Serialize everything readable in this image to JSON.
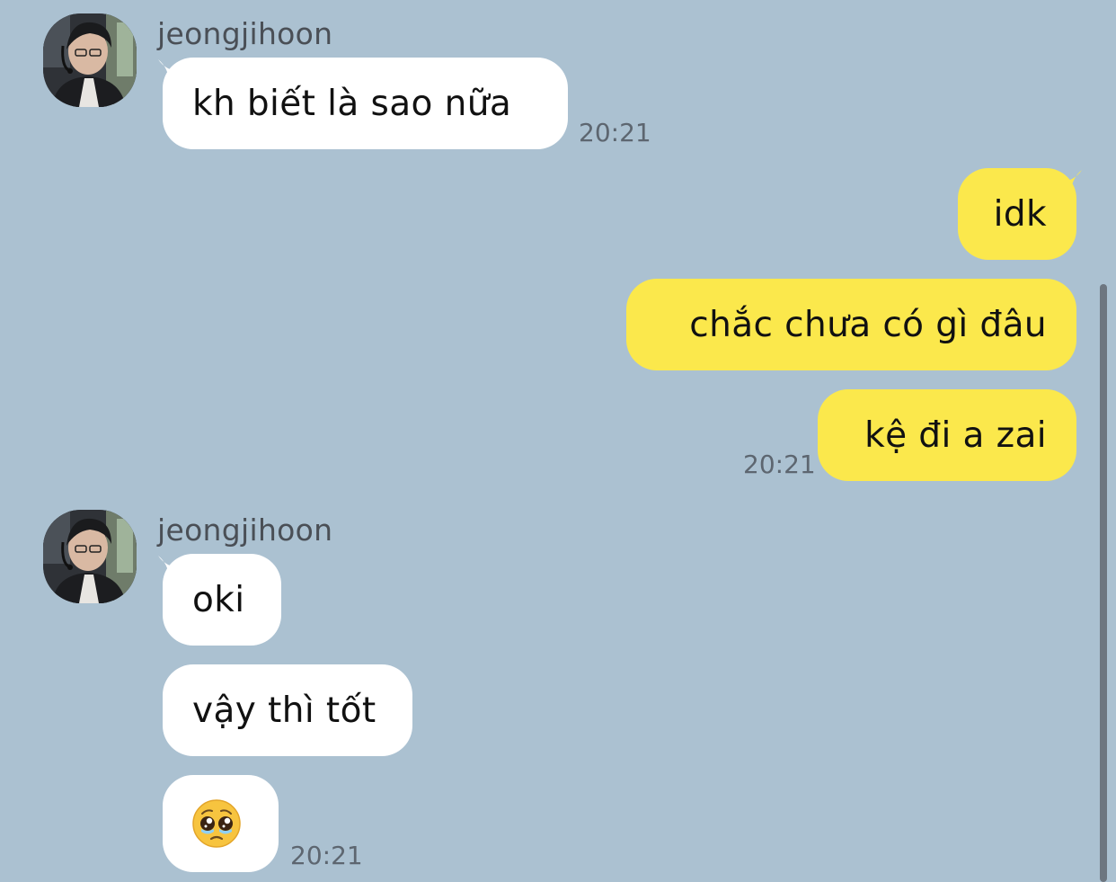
{
  "app": {
    "background_color": "#abc1d1",
    "incoming_bubble_color": "#ffffff",
    "outgoing_bubble_color": "#fbe84c"
  },
  "messages": {
    "group1": {
      "sender": "jeongjihoon",
      "avatar_icon": "user-avatar-photo",
      "bubbles": [
        "kh biết là sao nữa"
      ],
      "time": "20:21"
    },
    "group2": {
      "bubbles": [
        "idk",
        "chắc chưa có gì đâu",
        "kệ đi a zai"
      ],
      "time": "20:21"
    },
    "group3": {
      "sender": "jeongjihoon",
      "avatar_icon": "user-avatar-photo",
      "bubbles": [
        "oki",
        "vậy thì tốt"
      ],
      "emoji_icon": "pleading-face-emoji",
      "time": "20:21"
    }
  }
}
